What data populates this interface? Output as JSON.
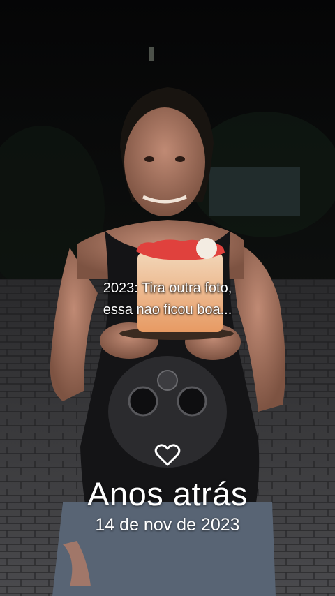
{
  "caption": {
    "line1": "2023: Tira outra foto,",
    "line2": "essa nao ficou boa..."
  },
  "memory": {
    "icon": "heart-outline-icon",
    "title": "Anos atrás",
    "date": "14 de nov de 2023"
  },
  "colors": {
    "text": "#ffffff",
    "background": "#0b0b0d"
  }
}
